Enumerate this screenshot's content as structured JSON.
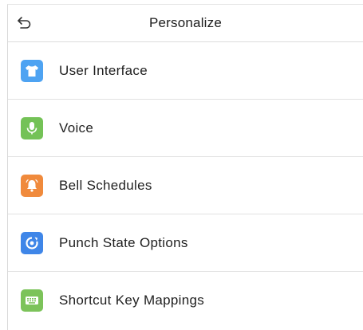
{
  "header": {
    "title": "Personalize",
    "back_icon": "back-arrow-icon"
  },
  "menu": {
    "items": [
      {
        "label": "User Interface",
        "icon": "tshirt-icon",
        "color": "#4ea3f2"
      },
      {
        "label": "Voice",
        "icon": "microphone-icon",
        "color": "#74c257"
      },
      {
        "label": "Bell Schedules",
        "icon": "bell-icon",
        "color": "#f08a3c"
      },
      {
        "label": "Punch State Options",
        "icon": "punch-state-icon",
        "color": "#3f86e8"
      },
      {
        "label": "Shortcut Key Mappings",
        "icon": "keyboard-icon",
        "color": "#7cc35a"
      }
    ]
  }
}
